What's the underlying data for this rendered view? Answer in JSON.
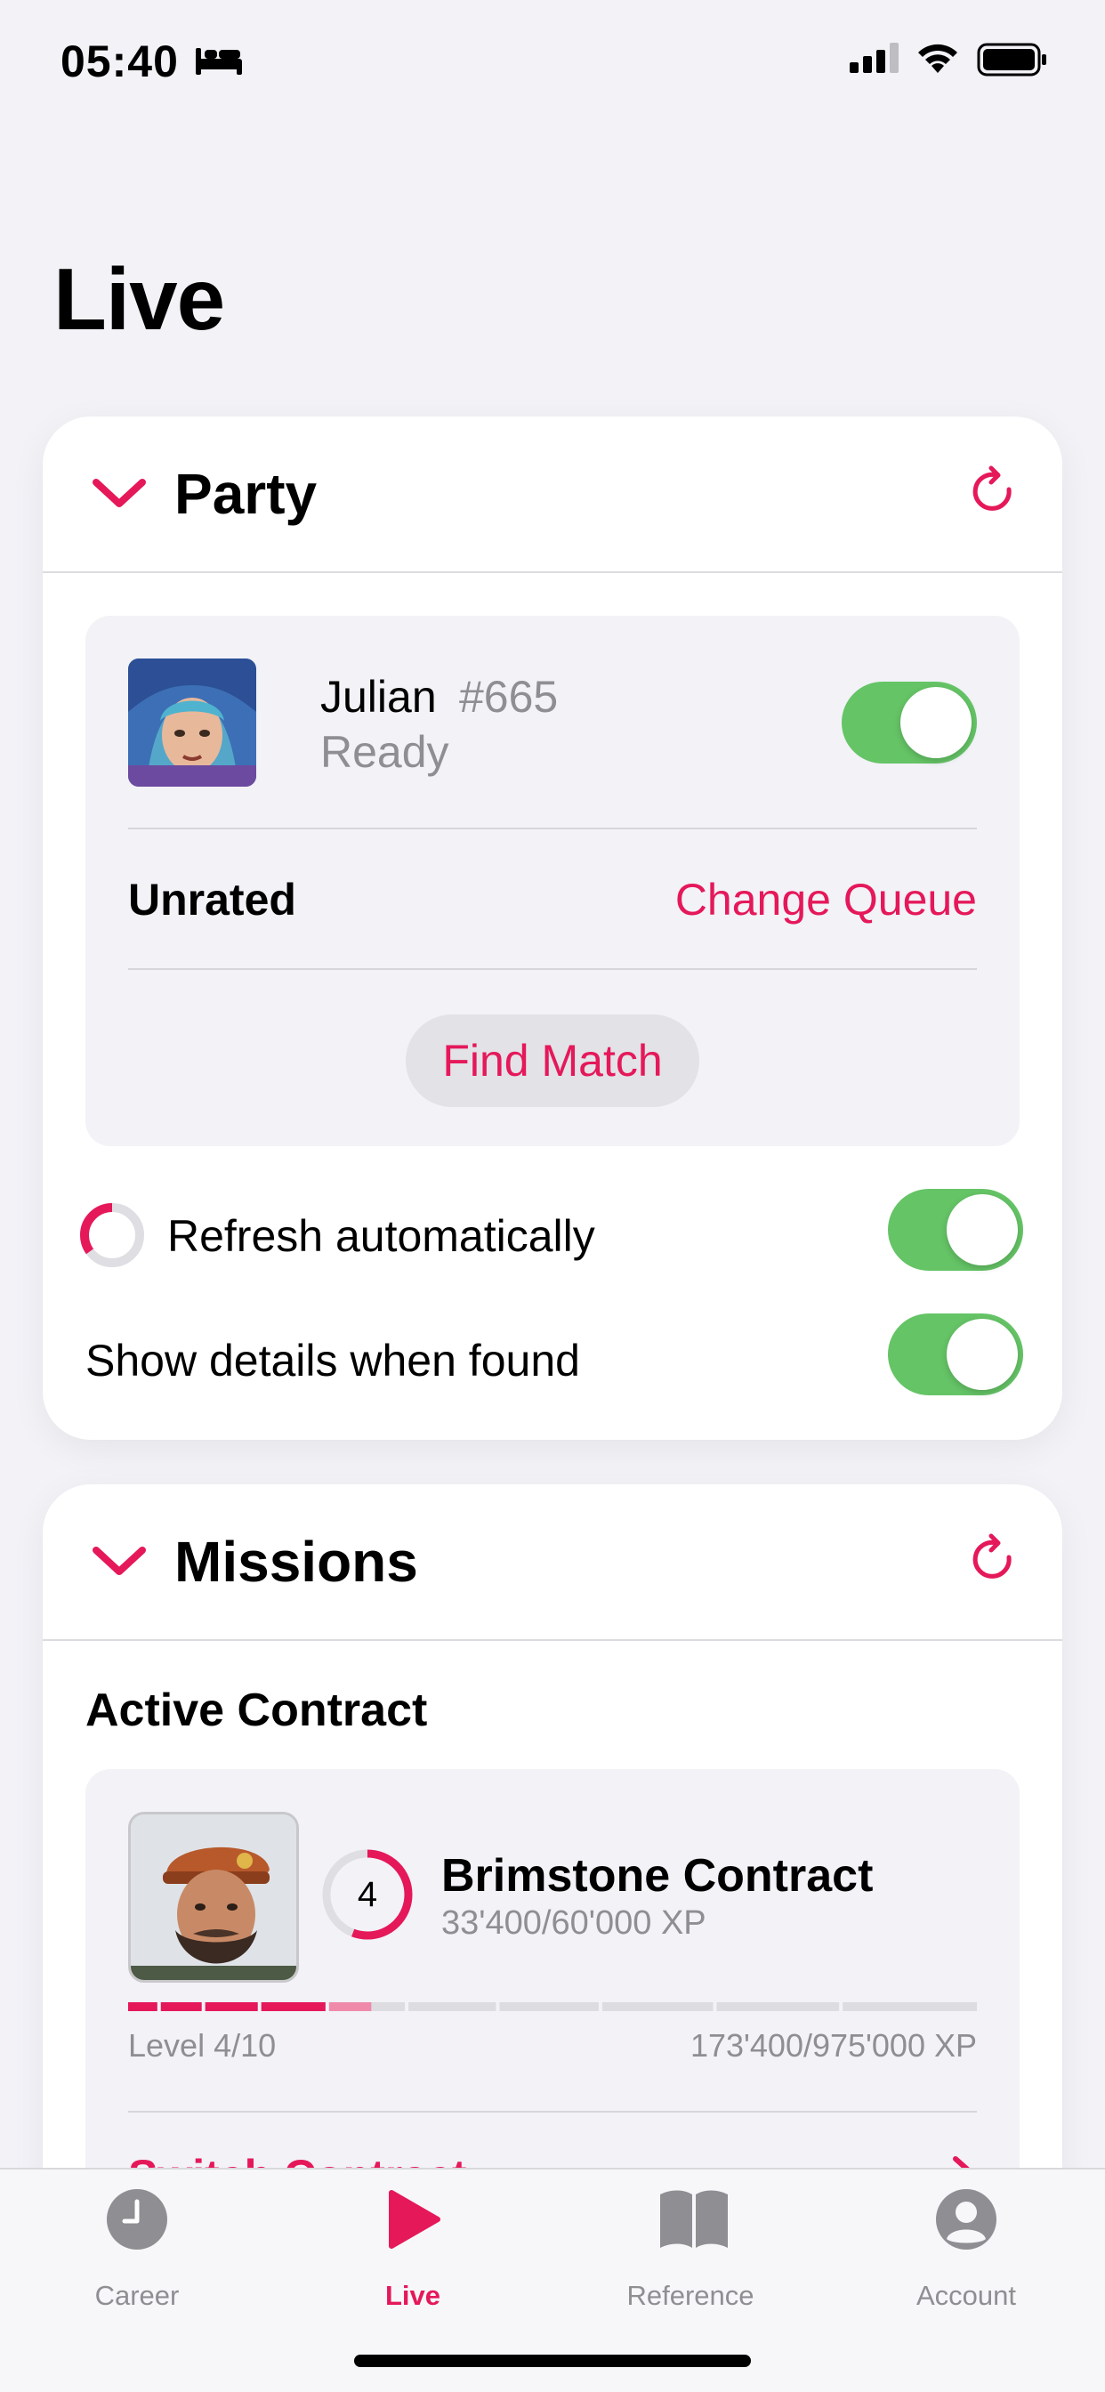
{
  "status_bar": {
    "time": "05:40",
    "icons": [
      "bed-icon",
      "signal-icon",
      "wifi-icon",
      "battery-icon"
    ]
  },
  "page": {
    "title": "Live"
  },
  "party": {
    "title": "Party",
    "player": {
      "name": "Julian",
      "tag": "#665",
      "status": "Ready",
      "ready_toggle": true
    },
    "queue": {
      "label": "Unrated",
      "change_label": "Change Queue"
    },
    "find_match_label": "Find Match",
    "refresh_auto": {
      "label": "Refresh automatically",
      "enabled": true,
      "countdown_fraction": 0.35
    },
    "show_details": {
      "label": "Show details when found",
      "enabled": true
    }
  },
  "missions": {
    "title": "Missions",
    "active_contract": {
      "heading": "Active Contract",
      "name": "Brimstone Contract",
      "level": "4",
      "level_xp": "33'400/60'000 XP",
      "level_progress": 0.557,
      "level_text": "Level 4/10",
      "total_xp": "173'400/975'000 XP",
      "completed_levels": 4,
      "total_levels": 10
    },
    "next_row_label": "Switch Contract"
  },
  "tabs": [
    {
      "label": "Career",
      "icon": "clock-icon",
      "active": false
    },
    {
      "label": "Live",
      "icon": "play-icon",
      "active": true
    },
    {
      "label": "Reference",
      "icon": "book-icon",
      "active": false
    },
    {
      "label": "Account",
      "icon": "person-icon",
      "active": false
    }
  ],
  "colors": {
    "accent": "#e5185a",
    "toggle_on": "#65c466",
    "secondary_text": "#8e8e93",
    "background": "#f2f2f7"
  }
}
